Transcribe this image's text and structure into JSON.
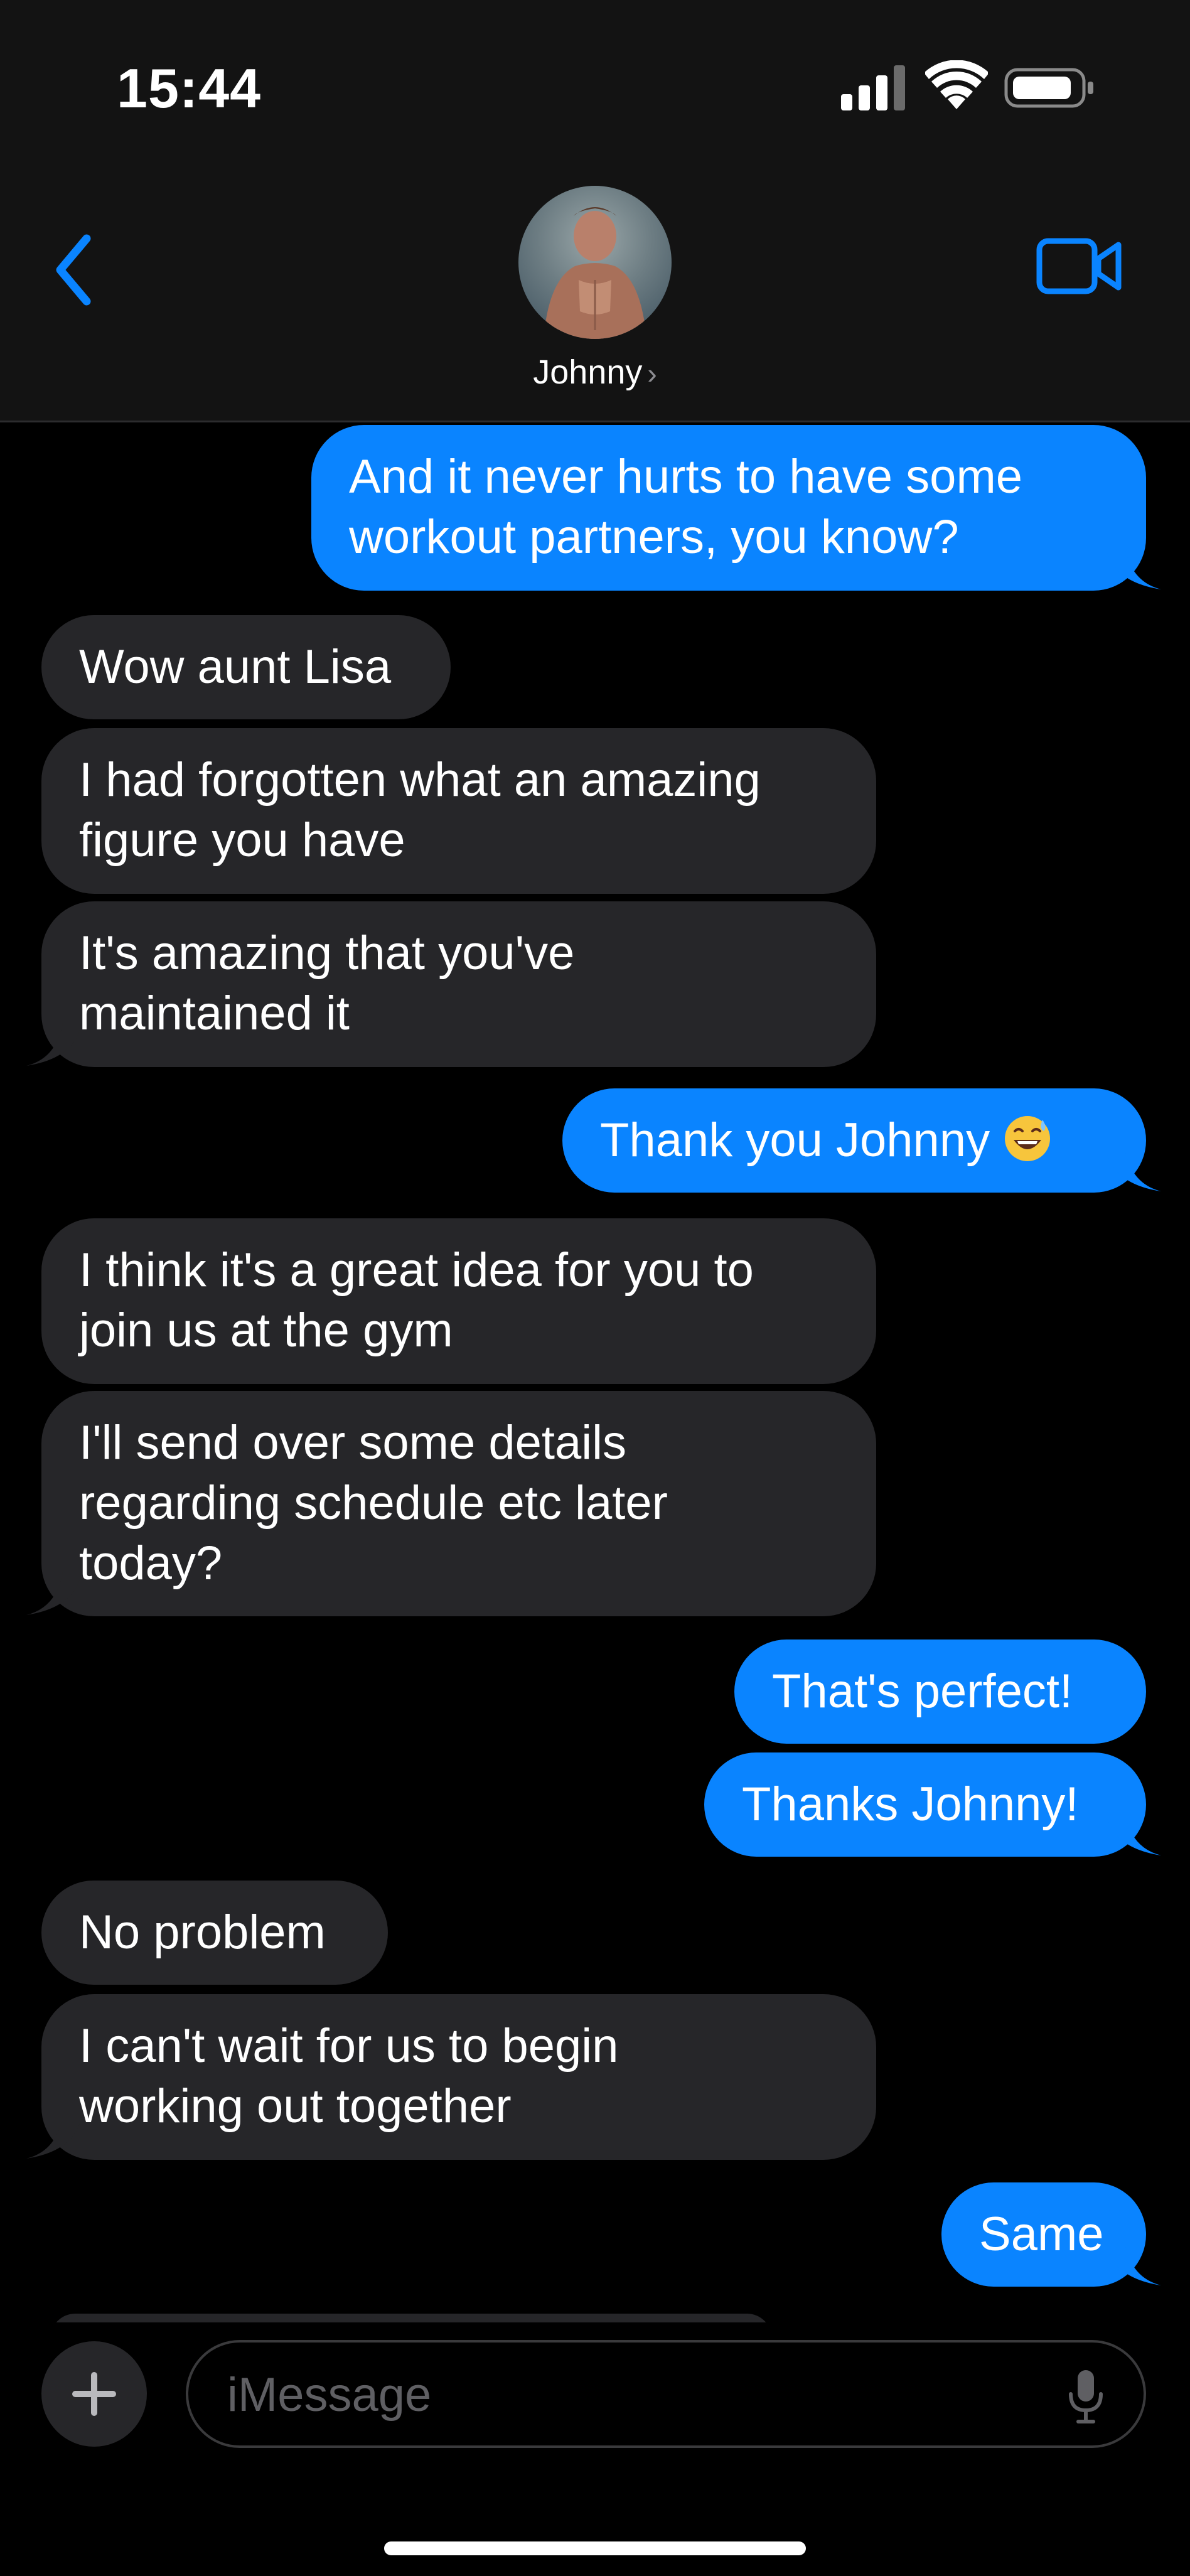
{
  "status_bar": {
    "time": "15:44"
  },
  "icons": {
    "signal": "cellular-signal-icon",
    "wifi": "wifi-icon",
    "battery": "battery-icon",
    "back": "chevron-left-icon",
    "video": "facetime-video-icon",
    "plus": "plus-icon",
    "mic": "microphone-icon",
    "emoji": "grinning-sweat-emoji"
  },
  "colors": {
    "accent": "#0a84ff",
    "incoming_bubble": "#262629",
    "header_bg": "#131313",
    "background": "#000000"
  },
  "header": {
    "contact_name": "Johnny",
    "chevron": "›"
  },
  "messages": [
    {
      "from": "me",
      "text": "And it never hurts to have some\nworkout partners, you know?"
    },
    {
      "from": "contact",
      "text": "Wow aunt Lisa"
    },
    {
      "from": "contact",
      "text": "I had forgotten what an amazing\nfigure you have"
    },
    {
      "from": "contact",
      "text": "It's amazing that you've\nmaintained it"
    },
    {
      "from": "me",
      "text": "Thank you Johnny"
    },
    {
      "from": "contact",
      "text": "I think it's a great idea for you to\njoin us at the gym"
    },
    {
      "from": "contact",
      "text": "I'll send over some details\nregarding schedule etc later\ntoday?"
    },
    {
      "from": "me",
      "text": "That's perfect!"
    },
    {
      "from": "me",
      "text": "Thanks Johnny!"
    },
    {
      "from": "contact",
      "text": "No problem"
    },
    {
      "from": "contact",
      "text": "I can't wait for us to begin\nworking out together"
    },
    {
      "from": "me",
      "text": "Same"
    }
  ],
  "composer": {
    "placeholder": "iMessage"
  }
}
